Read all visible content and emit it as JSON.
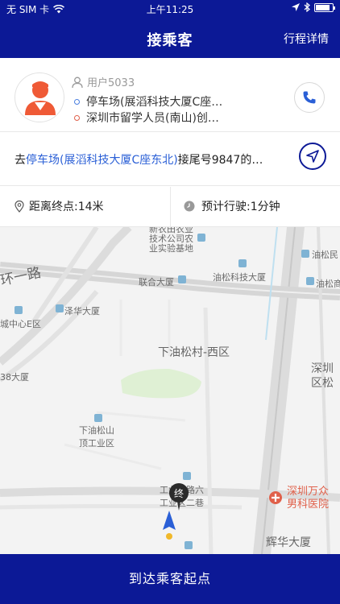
{
  "status_bar": {
    "carrier": "无 SIM 卡",
    "time": "上午11:25",
    "battery_level": 0.85
  },
  "nav": {
    "title": "接乘客",
    "right_link": "行程详情"
  },
  "passenger": {
    "name": "用户5033",
    "start_address": "停车场(展滔科技大厦C座…",
    "end_address": "深圳市留学人员(南山)创…"
  },
  "route": {
    "prefix": "去",
    "place": "停车场(展滔科技大厦C座东北)",
    "suffix": "接尾号9847的…"
  },
  "stats": {
    "distance": "距离终点:14米",
    "eta": "预计行驶:1分钟"
  },
  "map": {
    "labels": {
      "l1": "新农田农业",
      "l2": "技术公司农",
      "l3": "业实验基地",
      "l4": "油松民",
      "l5": "环一路",
      "l6": "联合大厦",
      "l7": "油松科技大厦",
      "l8": "油松商",
      "l9": "泽华大厦",
      "l10": "城中心E区",
      "l11": "下油松村-西区",
      "l12": "深圳",
      "l13": "区松",
      "l14": "38大厦",
      "l15": "下油松山",
      "l16": "顶工业区",
      "l17": "工业东路六",
      "l18": "工业区二巷",
      "l19": "深圳万众",
      "l20": "男科医院",
      "l21": "辉华大厦",
      "end_marker": "终"
    }
  },
  "bottom_button": "到达乘客起点"
}
